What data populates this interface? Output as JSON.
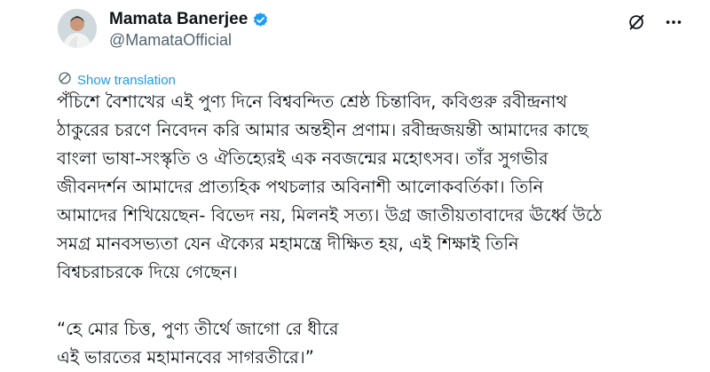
{
  "author": {
    "name": "Mamata Banerjee",
    "handle": "@MamataOfficial",
    "verified": true
  },
  "translate": {
    "label": "Show translation"
  },
  "tweet": {
    "paragraph1": [
      "পঁচিশে বৈশাখের এই পুণ্য দিনে বিশ্ববন্দিত শ্রেষ্ঠ চিন্তাবিদ, কবিগুরু রবীন্দ্রনাথ",
      "ঠাকুরের চরণে নিবেদন করি আমার অন্তহীন প্রণাম। রবীন্দ্রজয়ন্তী আমাদের কাছে",
      "বাংলা ভাষা-সংস্কৃতি ও ঐতিহ্যেরই এক নবজন্মের মহোৎসব। তাঁর সুগভীর",
      "জীবনদর্শন আমাদের প্রাত্যহিক পথচলার অবিনাশী আলোকবর্তিকা। তিনি",
      "আমাদের শিখিয়েছেন- বিভেদ নয়, মিলনই সত্য। উগ্র জাতীয়তাবাদের ঊর্ধ্বে উঠে",
      "সমগ্র মানবসভ্যতা যেন ঐক্যের মহামন্ত্রে দীক্ষিত হয়, এই শিক্ষাই তিনি",
      "বিশ্বচরাচরকে দিয়ে গেছেন।"
    ],
    "quote": [
      "“হে মোর চিত্ত, পুণ্য তীর্থে জাগো রে ধীরে",
      "এই ভারতের মহামানবের সাগরতীরে।”"
    ]
  },
  "colors": {
    "accent": "#1d9bf0",
    "text": "#0f1419",
    "muted": "#536471"
  },
  "icons": [
    "grok-icon",
    "more-icon",
    "globe-icon",
    "verified-badge-icon"
  ]
}
